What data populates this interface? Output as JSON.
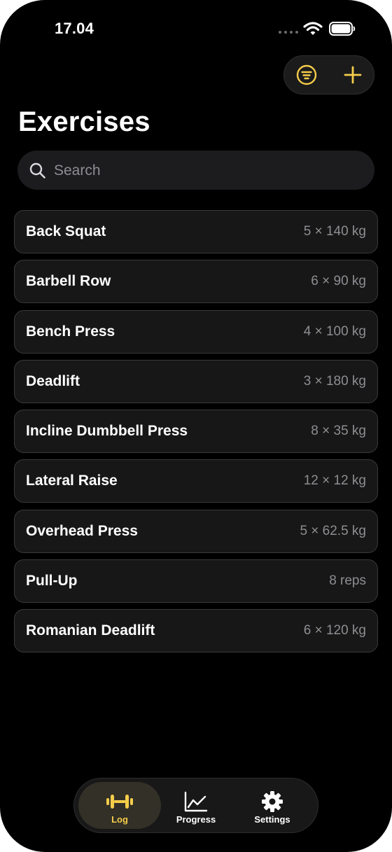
{
  "status_bar": {
    "time": "17.04"
  },
  "colors": {
    "accent": "#f5cd4a",
    "background": "#000000",
    "card": "#171717",
    "secondary_text": "#8e8e93"
  },
  "toolbar": {
    "filter_icon": "filter-circle-icon",
    "add_icon": "plus-icon"
  },
  "page": {
    "title": "Exercises"
  },
  "search": {
    "placeholder": "Search",
    "value": ""
  },
  "exercises": [
    {
      "name": "Back Squat",
      "detail": "5 × 140 kg"
    },
    {
      "name": "Barbell Row",
      "detail": "6 × 90 kg"
    },
    {
      "name": "Bench Press",
      "detail": "4 × 100 kg"
    },
    {
      "name": "Deadlift",
      "detail": "3 × 180 kg"
    },
    {
      "name": "Incline Dumbbell Press",
      "detail": "8 × 35 kg"
    },
    {
      "name": "Lateral Raise",
      "detail": "12 × 12 kg"
    },
    {
      "name": "Overhead Press",
      "detail": "5 × 62.5 kg"
    },
    {
      "name": "Pull-Up",
      "detail": "8 reps"
    },
    {
      "name": "Romanian Deadlift",
      "detail": "6 × 120 kg"
    }
  ],
  "tab_bar": {
    "tabs": [
      {
        "label": "Log",
        "icon": "dumbbell-icon",
        "active": true
      },
      {
        "label": "Progress",
        "icon": "chart-line-icon",
        "active": false
      },
      {
        "label": "Settings",
        "icon": "gear-icon",
        "active": false
      }
    ]
  }
}
